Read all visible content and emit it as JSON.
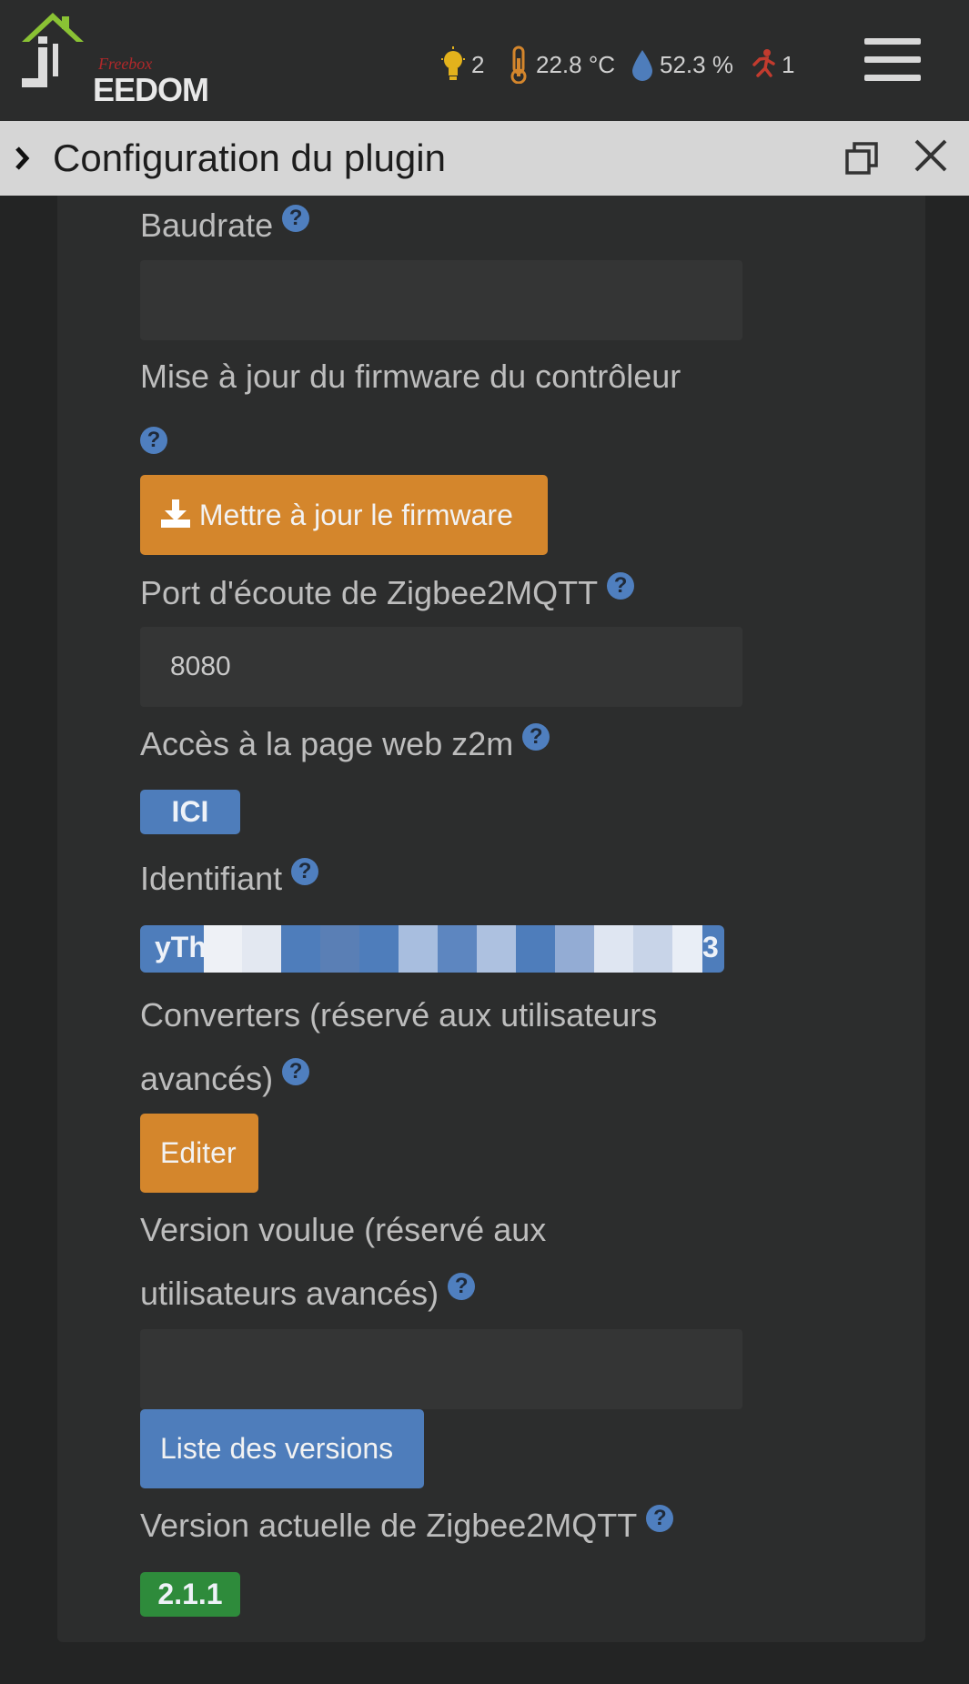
{
  "navbar": {
    "logo_sub": "Freebox",
    "logo_ee": "EEDOM",
    "summary": {
      "lights": "2",
      "temperature": "22.8 °C",
      "humidity": "52.3 %",
      "motion": "1"
    }
  },
  "modal": {
    "title": "Configuration du plugin"
  },
  "form": {
    "baudrate_label": "Baudrate",
    "baudrate_value": "",
    "firmware_label": "Mise à jour du firmware du contrôleur",
    "firmware_button": "Mettre à jour le firmware",
    "port_label": "Port d'écoute de Zigbee2MQTT",
    "port_value": "8080",
    "web_label": "Accès à la page web z2m",
    "web_button": "ICI",
    "identifiant_label": "Identifiant",
    "identifiant_value": "yTh",
    "identifiant_tail": "3",
    "converters_label_1": "Converters (réservé aux utilisateurs",
    "converters_label_2": "avancés)",
    "converters_button": "Editer",
    "version_label_1": "Version voulue (réservé aux",
    "version_label_2": "utilisateurs avancés)",
    "version_value": "",
    "versions_button": "Liste des versions",
    "current_version_label": "Version actuelle de Zigbee2MQTT",
    "current_version": "2.1.1"
  },
  "help_glyph": "?",
  "colors": {
    "orange": "#d4862c",
    "blue": "#4e7dbb",
    "green": "#2e8b3b",
    "help": "#4f7fbf"
  }
}
